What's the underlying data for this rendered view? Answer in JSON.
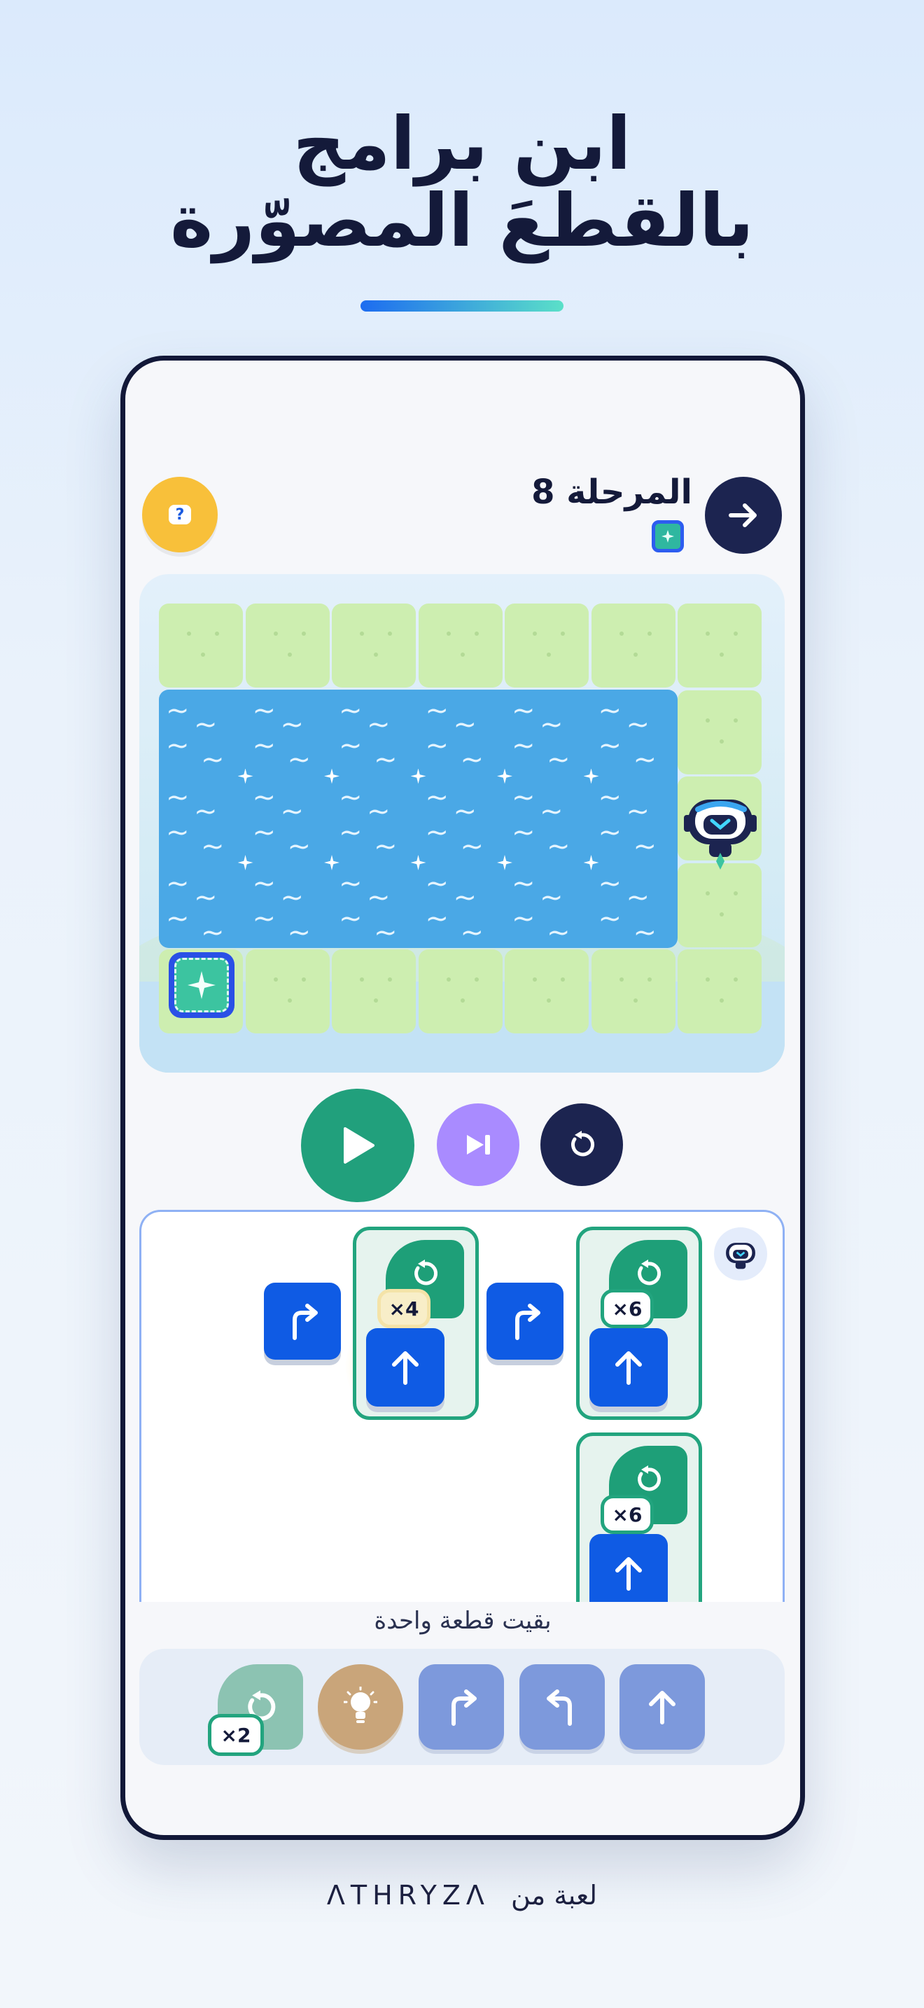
{
  "headline": {
    "line1": "ابن برامج",
    "line2": "بالقطعَ المصوّرة"
  },
  "colors": {
    "accent_start": "#1d6cf0",
    "accent_end": "#5be0c8",
    "dark": "#121838",
    "play": "#21a07c",
    "step": "#a98bff",
    "help": "#f8c03a",
    "block_blue": "#0f5be4",
    "loop_green": "#1e9f78"
  },
  "header": {
    "stage_title": "المرحلة 8",
    "help_icon": "question-bubble-icon",
    "next_icon": "arrow-right-icon"
  },
  "controls": {
    "play_icon": "play-icon",
    "step_icon": "step-forward-icon",
    "reset_icon": "reset-icon"
  },
  "program": {
    "loops": [
      {
        "count_label": "×4"
      },
      {
        "count_label": "×6"
      },
      {
        "count_label": "×6"
      }
    ]
  },
  "tray": {
    "remaining_text": "بقيت قطعة واحدة",
    "loop_count_label": "×2",
    "blocks": [
      "loop-icon",
      "lightbulb-icon",
      "turn-right-icon",
      "turn-left-icon",
      "arrow-up-icon"
    ]
  },
  "footer": {
    "text": "لعبة من",
    "brand": "ΛTHRYZΛ"
  }
}
